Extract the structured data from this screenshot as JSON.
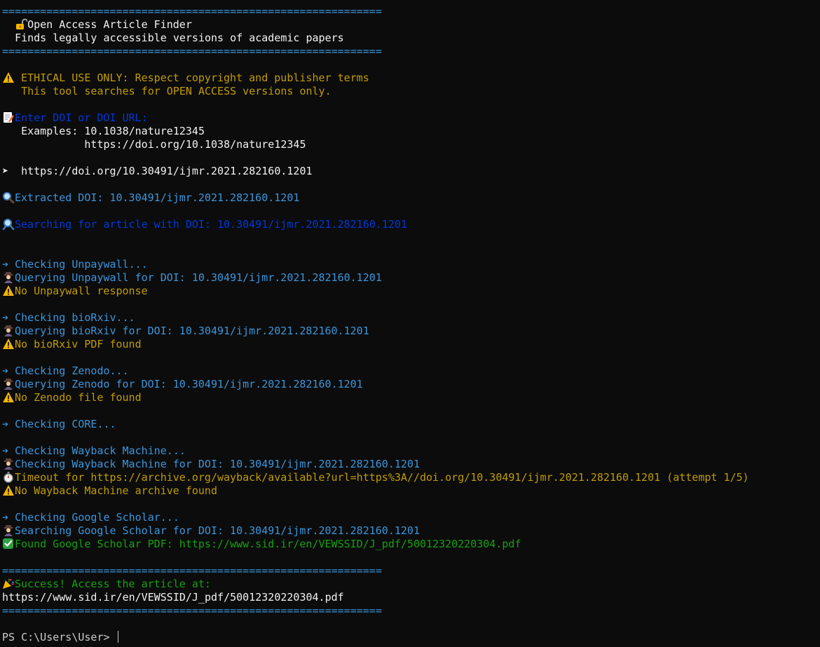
{
  "rule": "============================================================",
  "banner": {
    "title": "Open Access Article Finder",
    "subtitle": "Finds legally accessible versions of academic papers"
  },
  "notice": {
    "line1": "ETHICAL USE ONLY: Respect copyright and publisher terms",
    "line2": "This tool searches for OPEN ACCESS versions only."
  },
  "prompt": {
    "label": "Enter DOI or DOI URL:",
    "examples_label": "Examples:",
    "example1": "10.1038/nature12345",
    "example2": "https://doi.org/10.1038/nature12345"
  },
  "user_input": "https://doi.org/10.30491/ijmr.2021.282160.1201",
  "extracted": "Extracted DOI: 10.30491/ijmr.2021.282160.1201",
  "searching": "Searching for article with DOI: 10.30491/ijmr.2021.282160.1201",
  "checks": {
    "unpaywall": {
      "check": "Checking Unpaywall...",
      "query": "Querying Unpaywall for DOI: 10.30491/ijmr.2021.282160.1201",
      "result": "No Unpaywall response"
    },
    "biorxiv": {
      "check": "Checking bioRxiv...",
      "query": "Querying bioRxiv for DOI: 10.30491/ijmr.2021.282160.1201",
      "result": "No bioRxiv PDF found"
    },
    "zenodo": {
      "check": "Checking Zenodo...",
      "query": "Querying Zenodo for DOI: 10.30491/ijmr.2021.282160.1201",
      "result": "No Zenodo file found"
    },
    "core": {
      "check": "Checking CORE..."
    },
    "wayback": {
      "check": "Checking Wayback Machine...",
      "query": "Checking Wayback Machine for DOI: 10.30491/ijmr.2021.282160.1201",
      "timeout": "Timeout for https://archive.org/wayback/available?url=https%3A//doi.org/10.30491/ijmr.2021.282160.1201 (attempt 1/5)",
      "result": "No Wayback Machine archive found"
    },
    "scholar": {
      "check": "Checking Google Scholar...",
      "query": "Searching Google Scholar for DOI: 10.30491/ijmr.2021.282160.1201",
      "result": "Found Google Scholar PDF: https://www.sid.ir/en/VEWSSID/J_pdf/50012320220304.pdf"
    }
  },
  "success": {
    "message": "Success! Access the article at:",
    "url": "https://www.sid.ir/en/VEWSSID/J_pdf/50012320220304.pdf"
  },
  "shell_prompt": "PS C:\\Users\\User> ",
  "colors": {
    "background": "#0c0c0c",
    "foreground": "#cccccc",
    "white": "#f2f2f2",
    "yellow": "#c19c00",
    "blue": "#0037da",
    "cyan": "#3a96dd",
    "green": "#13a10e"
  },
  "icons": {
    "title": "unlocked-padlock-icon",
    "warning": "warning-icon",
    "memo": "memo-icon",
    "arrowhead": "arrowhead-icon",
    "magnifier_right": "magnifier-right-icon",
    "magnifier_left": "magnifier-left-icon",
    "arrow": "right-arrow-icon",
    "detective": "detective-icon",
    "stopwatch": "stopwatch-icon",
    "check": "check-mark-icon",
    "party": "party-popper-icon"
  }
}
